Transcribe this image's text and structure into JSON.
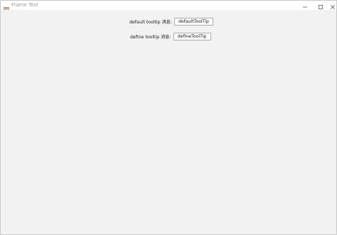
{
  "window": {
    "title": "Frame Test",
    "icon": "java-app-icon",
    "controls": [
      "minimize-icon",
      "maximize-icon",
      "close-icon"
    ]
  },
  "rows": [
    {
      "label": "default tooltip 消息:",
      "button_label": "defaultToolTip"
    },
    {
      "label": "define tooltip 消息:",
      "button_label": "defineToolTip"
    }
  ],
  "colors": {
    "content_background": "#f2f2f2",
    "titlebar_background": "#ffffff",
    "button_border": "#adadad"
  }
}
